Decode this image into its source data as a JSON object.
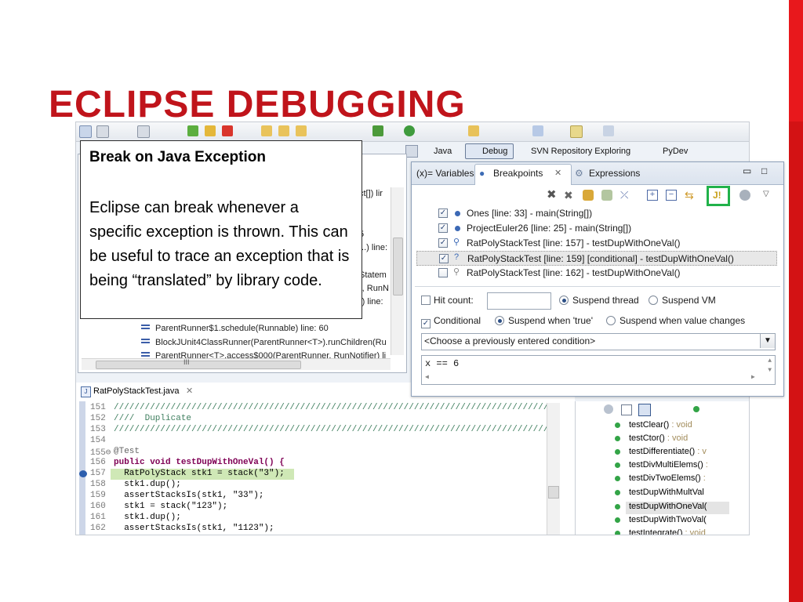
{
  "slide": {
    "title": "ECLIPSE DEBUGGING"
  },
  "callout": {
    "heading": "Break on Java Exception",
    "body": "Eclipse can break whenever a specific exception is thrown. This can be useful to trace an exception that is being “translated” by library code."
  },
  "perspectives": [
    "Java",
    "Debug",
    "SVN Repository Exploring",
    "PyDev"
  ],
  "stack": {
    "fragments": [
      "ct[]) lir",
      "5",
      "...) line:",
      "Statem",
      "), RunN",
      "r) line:"
    ],
    "frames": [
      "ParentRunner$1.schedule(Runnable) line: 60",
      "BlockJUnit4ClassRunner(ParentRunner<T>).runChildren(Ru",
      "ParentRunner<T>.access$000(ParentRunner, RunNotifier) li"
    ],
    "hscroll_label": "III"
  },
  "breakpoints_view": {
    "tabs": [
      "(x)= Variables",
      "Breakpoints",
      "Expressions"
    ],
    "rows": [
      {
        "checked": true,
        "label": "Ones [line: 33] - main(String[])"
      },
      {
        "checked": true,
        "label": "ProjectEuler26 [line: 25] - main(String[])"
      },
      {
        "checked": true,
        "label": "RatPolyStackTest [line: 157] - testDupWithOneVal()"
      },
      {
        "checked": true,
        "label": "RatPolyStackTest [line: 159] [conditional] - testDupWithOneVal()"
      },
      {
        "checked": false,
        "label": "RatPolyStackTest [line: 162] - testDupWithOneVal()"
      }
    ],
    "hit_count_label": "Hit count:",
    "suspend_thread": "Suspend thread",
    "suspend_vm": "Suspend VM",
    "conditional_label": "Conditional",
    "suspend_true": "Suspend when 'true'",
    "suspend_changes": "Suspend when value changes",
    "combo_value": "<Choose a previously entered condition>",
    "condition": "x == 6",
    "highlight_color": "#21b24a"
  },
  "editor": {
    "tab": "RatPolyStackTest.java",
    "lines": [
      {
        "n": "151",
        "t": "////////////////////////////////////////////////////////////////////////////////////"
      },
      {
        "n": "152",
        "t": "////  Duplicate"
      },
      {
        "n": "153",
        "t": "////////////////////////////////////////////////////////////////////////////////////"
      },
      {
        "n": "154",
        "t": ""
      },
      {
        "n": "155⊖",
        "t": "@Test"
      },
      {
        "n": "156",
        "t": "public void testDupWithOneVal() {"
      },
      {
        "n": "157",
        "t": "  RatPolyStack stk1 = stack(\"3\");"
      },
      {
        "n": "158",
        "t": "  stk1.dup();"
      },
      {
        "n": "159",
        "t": "  assertStacksIs(stk1, \"33\");"
      },
      {
        "n": "160",
        "t": "  stk1 = stack(\"123\");"
      },
      {
        "n": "161",
        "t": "  stk1.dup();"
      },
      {
        "n": "162",
        "t": "  assertStacksIs(stk1, \"1123\");"
      }
    ]
  },
  "outline": {
    "items": [
      {
        "name": "testClear()",
        "type": " : void"
      },
      {
        "name": "testCtor()",
        "type": " : void"
      },
      {
        "name": "testDifferentiate()",
        "type": " : v"
      },
      {
        "name": "testDivMultiElems()",
        "type": " :"
      },
      {
        "name": "testDivTwoElems()",
        "type": " :"
      },
      {
        "name": "testDupWithMultVal",
        "type": ""
      },
      {
        "name": "testDupWithOneVal(",
        "type": ""
      },
      {
        "name": "testDupWithTwoVal(",
        "type": ""
      },
      {
        "name": "testIntegrate()",
        "type": " : void"
      }
    ]
  }
}
